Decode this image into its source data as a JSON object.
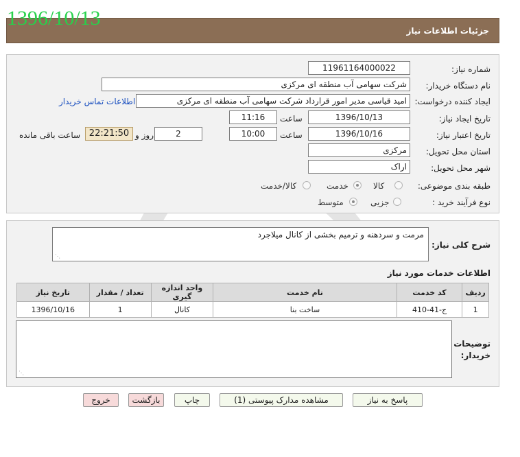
{
  "overlay_date": "1396/10/13",
  "header": {
    "title": "جزئیات اطلاعات نیاز"
  },
  "form": {
    "need_number_label": "شماره نیاز:",
    "need_number": "11961164000022",
    "buyer_org_label": "نام دستگاه خریدار:",
    "buyer_org": "شرکت سهامی آب منطقه ای مرکزی",
    "requester_label": "ایجاد کننده درخواست:",
    "requester": "امید قیاسی مدیر امور قرارداد شرکت سهامی آب منطقه ای مرکزی",
    "buyer_contact_link": "اطلاعات تماس خریدار",
    "create_date_label": "تاریخ ایجاد نیاز:",
    "create_date": "1396/10/13",
    "create_time_label": "ساعت",
    "create_time": "11:16",
    "validity_date_label": "تاریخ اعتبار نیاز:",
    "validity_date": "1396/10/16",
    "validity_time_label": "ساعت",
    "validity_time": "10:00",
    "days_value": "2",
    "days_label": "روز و",
    "remaining_time": "22:21:50",
    "remaining_label": "ساعت باقی مانده",
    "province_label": "استان محل تحویل:",
    "province": "مرکزی",
    "city_label": "شهر محل تحویل:",
    "city": "اراک",
    "category_label": "طبقه بندی موضوعی:",
    "category_options": [
      "کالا",
      "خدمت",
      "کالا/خدمت"
    ],
    "category_selected": "خدمت",
    "process_label": "نوع فرآیند خرید :",
    "process_options": [
      "جزیی",
      "متوسط"
    ],
    "process_selected": "متوسط"
  },
  "description": {
    "label": "شرح کلی نیاز:",
    "text": "مرمت و سردهنه و ترمیم بخشی از کانال میلاجرد"
  },
  "services": {
    "title": "اطلاعات خدمات مورد نیاز",
    "columns": [
      "ردیف",
      "کد خدمت",
      "نام خدمت",
      "واحد اندازه گیری",
      "تعداد / مقدار",
      "تاریخ نیاز"
    ],
    "rows": [
      [
        "1",
        "ج-41-410",
        "ساخت بنا",
        "کانال",
        "1",
        "1396/10/16"
      ]
    ]
  },
  "buyer_notes": {
    "label_line1": "توضیحات",
    "label_line2": "خریدار:",
    "text": ""
  },
  "buttons": {
    "reply": "پاسخ به نیاز",
    "view_docs": "مشاهده مدارک پیوستی (1)",
    "print": "چاپ",
    "back": "بازگشت",
    "exit": "خروج"
  },
  "colors": {
    "header_bg": "#8b6e55",
    "overlay_text": "#27d14b",
    "panel_bg": "#f2f2f2",
    "link": "#1a4fbf",
    "time_box": "#f3e6c8",
    "exit_button": "#f7dada"
  }
}
